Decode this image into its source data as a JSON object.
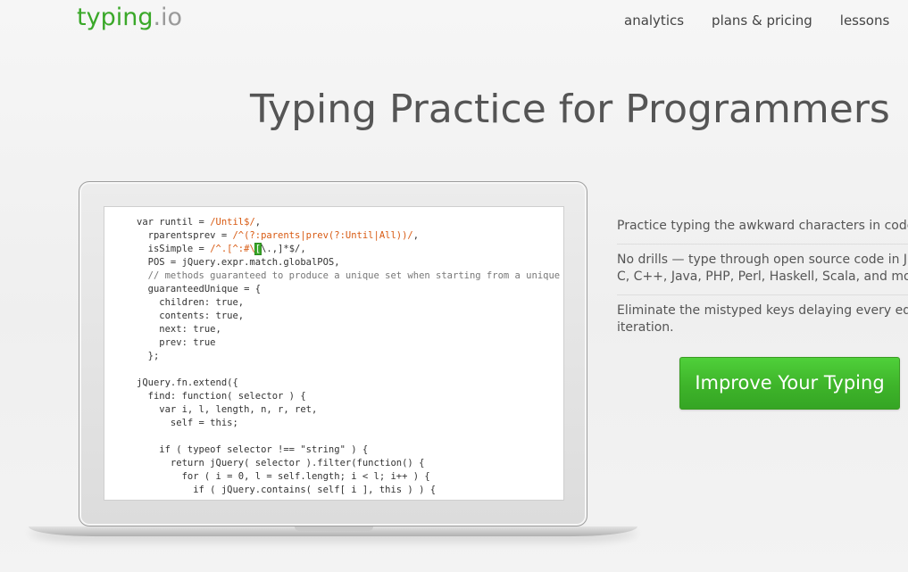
{
  "header": {
    "logo_brand": "typing",
    "logo_tld": ".io",
    "nav": {
      "analytics": "analytics",
      "plans": "plans & pricing",
      "lessons": "lessons"
    }
  },
  "hero": {
    "title": "Typing Practice for Programmers"
  },
  "code_preview": {
    "lines": [
      "var runtil = /Until$/,",
      "  rparentsprev = /^(?:parents|prev(?:Until|All))/,",
      "  isSimple = /^.[^:#\\[\\.,]*$/,",
      "  POS = jQuery.expr.match.globalPOS,",
      "  // methods guaranteed to produce a unique set when starting from a unique set",
      "  guaranteedUnique = {",
      "    children: true,",
      "    contents: true,",
      "    next: true,",
      "    prev: true",
      "  };",
      "",
      "jQuery.fn.extend({",
      "  find: function( selector ) {",
      "    var i, l, length, n, r, ret,",
      "      self = this;",
      "",
      "    if ( typeof selector !== \"string\" ) {",
      "      return jQuery( selector ).filter(function() {",
      "        for ( i = 0, l = self.length; i < l; i++ ) {",
      "          if ( jQuery.contains( self[ i ], this ) ) {"
    ]
  },
  "features": {
    "item1": "Practice typing the awkward characters in code.",
    "item2_line1": "No drills — type through open source code in Ja",
    "item2_line2": "C, C++, Java, PHP, Perl, Haskell, Scala, and more.",
    "item3_line1": "Eliminate the mistyped keys delaying every edit",
    "item3_line2": "iteration."
  },
  "cta": {
    "label": "Improve Your Typing"
  },
  "colors": {
    "brand_green": "#3aa829",
    "code_string": "#d85a12",
    "cta_green": "#3eb42a"
  }
}
